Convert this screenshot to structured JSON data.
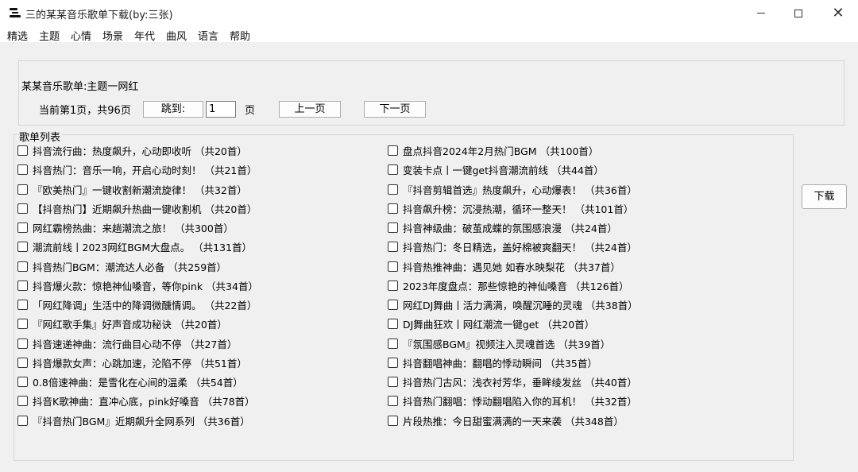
{
  "window": {
    "title": "三的某某音乐歌单下载(by:三张)",
    "minimize_icon": "minimize-icon",
    "maximize_icon": "maximize-icon",
    "close_glyph": "✕"
  },
  "menu": [
    "精选",
    "主题",
    "心情",
    "场景",
    "年代",
    "曲风",
    "语言",
    "帮助"
  ],
  "info": {
    "title": "某某音乐歌单:主题一网红",
    "page_status": "当前第1页，共96页",
    "jump_label": "跳到:",
    "page_value": "1",
    "page_unit": "页",
    "prev_label": "上一页",
    "next_label": "下一页"
  },
  "playlist_section_label": "歌单列表",
  "download_label": "下载",
  "playlists_left": [
    "抖音流行曲：热度飙升，心动即收听 （共20首）",
    "抖音热门：音乐一响，开启心动时刻！ （共21首）",
    "『欧美热门』一键收割新潮流旋律！ （共32首）",
    "【抖音热门】近期飙升热曲一键收割机 （共20首）",
    "网红霸榜热曲：来趟潮流之旅！ （共300首）",
    "潮流前线丨2023网红BGM大盘点。 （共131首）",
    "抖音热门BGM：潮流达人必备 （共259首）",
    "抖音爆火款：惊艳神仙嗓音，等你pink （共34首）",
    "「网红降调」生活中的降调微醺情调。 （共22首）",
    "『网红歌手集』好声音成功秘诀 （共20首）",
    "抖音速递神曲：流行曲目心动不停 （共27首）",
    "抖音爆款女声：心跳加速，沦陷不停 （共51首）",
    "0.8倍速神曲：是雪化在心间的温柔 （共54首）",
    "抖音K歌神曲：直冲心底，pink好嗓音 （共78首）",
    "『抖音热门BGM』近期飙升全网系列 （共36首）"
  ],
  "playlists_right": [
    "盘点抖音2024年2月热门BGM （共100首）",
    "变装卡点丨一键get抖音潮流前线 （共44首）",
    "『抖音剪辑首选』热度飙升，心动爆表！ （共36首）",
    "抖音飙升榜：沉浸热潮，循环一整天！ （共101首）",
    "抖音神级曲：破茧成蝶的氛围感浪漫 （共24首）",
    "抖音热门：冬日精选，盖好棉被爽翻天！ （共24首）",
    "抖音热推神曲：遇见她 如春水映梨花 （共37首）",
    "2023年度盘点：那些惊艳的神仙嗓音 （共126首）",
    "网红DJ舞曲丨活力满满，唤醒沉睡的灵魂 （共38首）",
    "DJ舞曲狂欢丨网红潮流一键get （共20首）",
    "『氛围感BGM』视频注入灵魂首选 （共39首）",
    "抖音翻唱神曲：翻唱的悸动瞬间 （共35首）",
    "抖音热门古风：浅衣衬芳华，垂眸绫发丝 （共40首）",
    "抖音热门翻唱：悸动翻唱陷入你的耳机！ （共32首）",
    "片段热推：今日甜蜜满满的一天来袭 （共348首）"
  ]
}
